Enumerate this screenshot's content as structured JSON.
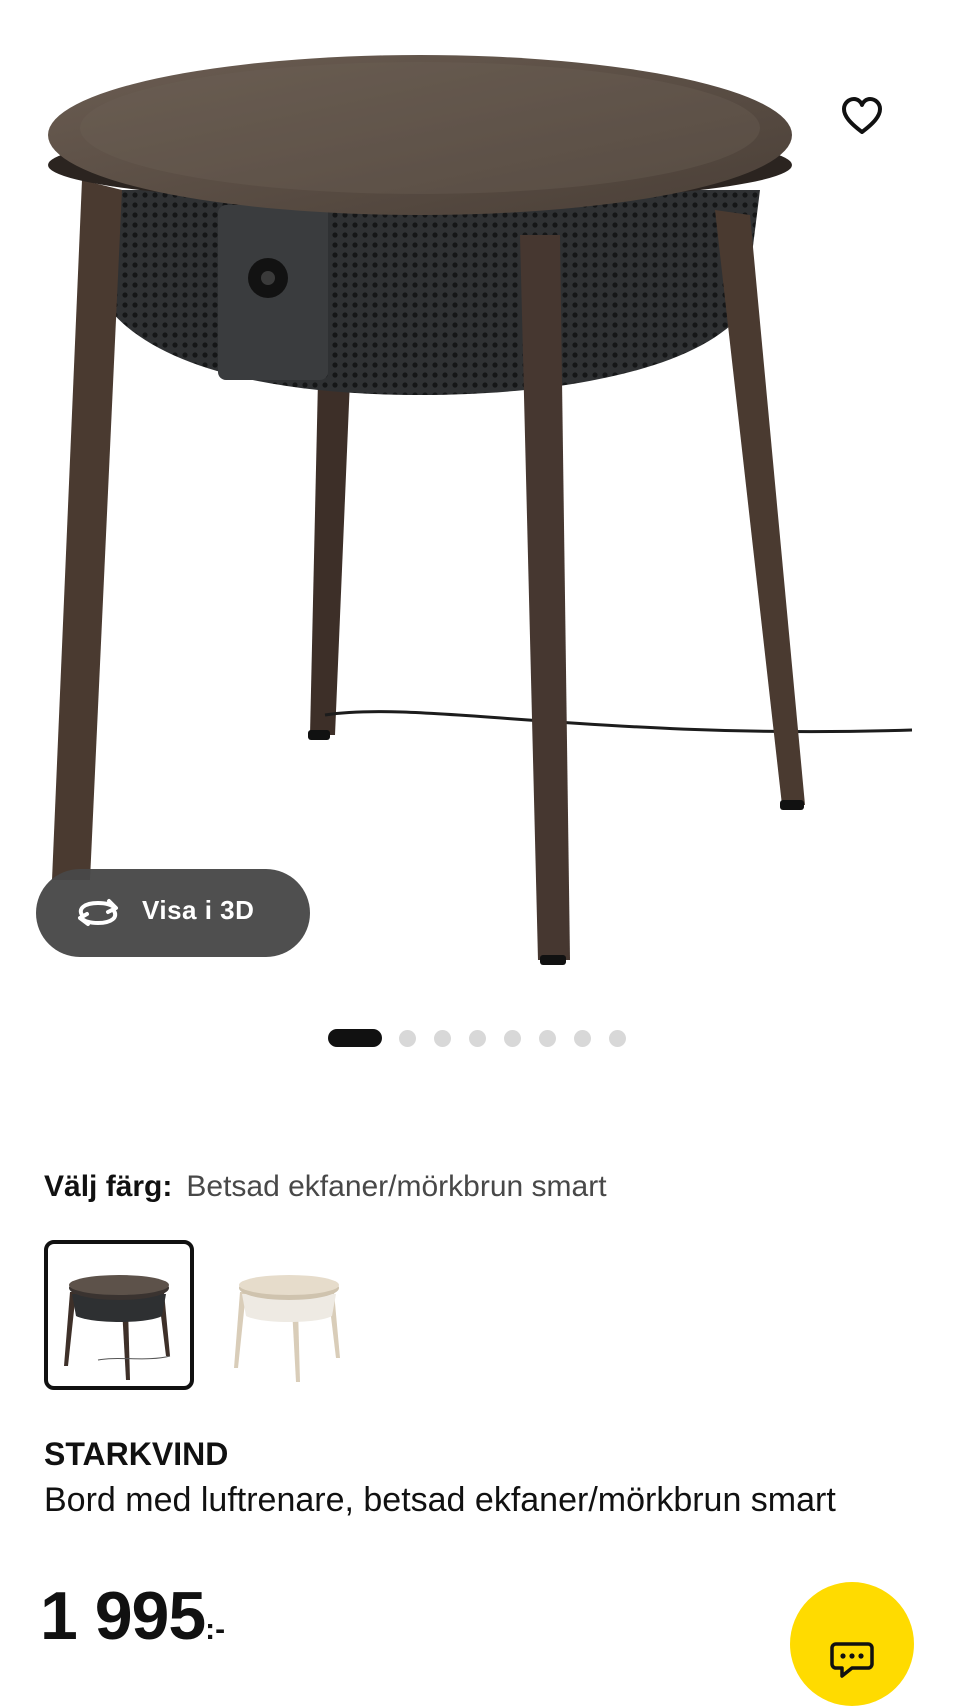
{
  "hero": {
    "favorite_icon": "heart-outline-icon",
    "view_3d": {
      "icon": "rotate-360-icon",
      "label": "Visa i 3D"
    },
    "gallery": {
      "total_images": 8,
      "active_index": 0
    }
  },
  "color_selector": {
    "label": "Välj färg:",
    "selected_value": "Betsad ekfaner/mörkbrun smart",
    "options": [
      {
        "name": "dark-brown",
        "selected": true
      },
      {
        "name": "light-beige",
        "selected": false
      }
    ]
  },
  "product": {
    "name": "STARKVIND",
    "description": "Bord med luftrenare, betsad ekfaner/mörkbrun smart",
    "price": "1 995",
    "price_suffix": ":-"
  },
  "chat": {
    "icon": "chat-bubble-icon"
  },
  "colors": {
    "text": "#111111",
    "muted_text": "#484848",
    "chat_button": "#ffdb00",
    "pill_background": "#484848",
    "inactive_dot": "#d8d8d8"
  }
}
